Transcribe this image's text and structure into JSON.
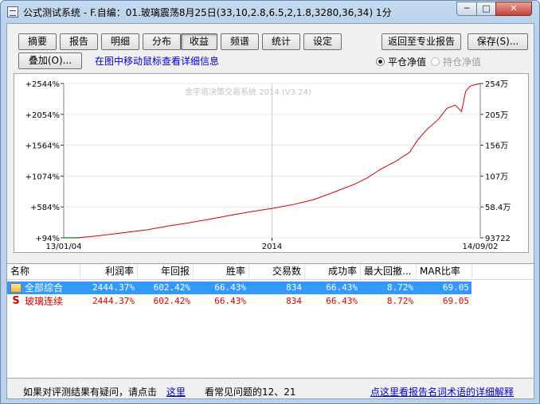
{
  "window": {
    "title": "公式测试系统 - F.自编：01.玻璃震荡8月25日(33,10,2.8,6.5,2,1.8,3280,36,34) 1分",
    "min_glyph": "─",
    "max_glyph": "□",
    "close_glyph": "✕"
  },
  "tabs": [
    {
      "label": "摘要",
      "active": false
    },
    {
      "label": "报告",
      "active": false
    },
    {
      "label": "明细",
      "active": false
    },
    {
      "label": "分布",
      "active": false
    },
    {
      "label": "收益",
      "active": true
    },
    {
      "label": "频谱",
      "active": false
    },
    {
      "label": "统计",
      "active": false
    },
    {
      "label": "设定",
      "active": false
    }
  ],
  "toolbar": {
    "return_label": "返回至专业报告",
    "save_label": "保存(S)...",
    "overlay_label": "叠加(O)...",
    "hint": "在图中移动鼠标查看详细信息"
  },
  "mode": {
    "options": [
      {
        "label": "平仓净值",
        "selected": true
      },
      {
        "label": "持仓净值",
        "selected": false
      }
    ]
  },
  "chart_data": {
    "type": "line",
    "title": "",
    "watermark": "金字塔决策交易系统 2014 (V3.24)",
    "line_color": "#d40000",
    "grid": true,
    "y_left_ticks": [
      "+2544%",
      "+2054%",
      "+1564%",
      "+1074%",
      "+584%",
      "+94%"
    ],
    "y_right_ticks": [
      "254万",
      "205万",
      "156万",
      "107万",
      "58.4万",
      "93722"
    ],
    "x_ticks": [
      "13/01/04",
      "2014",
      "14/09/02"
    ],
    "ylim": [
      94,
      2544
    ],
    "series": [
      {
        "x": [
          0,
          0.03,
          0.06,
          0.1,
          0.15,
          0.2,
          0.25,
          0.3,
          0.35,
          0.4,
          0.45,
          0.5,
          0.55,
          0.6,
          0.65,
          0.7,
          0.73,
          0.76,
          0.8,
          0.83,
          0.85,
          0.87,
          0.9,
          0.92,
          0.94,
          0.955,
          0.965,
          0.975,
          0.985,
          1.0
        ],
        "values": [
          94,
          94,
          110,
          140,
          180,
          220,
          280,
          330,
          390,
          450,
          510,
          560,
          620,
          700,
          820,
          950,
          1050,
          1180,
          1320,
          1450,
          1650,
          1800,
          1980,
          2150,
          2200,
          2100,
          2420,
          2500,
          2520,
          2544
        ]
      }
    ]
  },
  "table": {
    "columns": [
      "名称",
      "利润率",
      "年回报",
      "胜率",
      "交易数",
      "成功率",
      "最大回撤...",
      "MAR比率"
    ],
    "rows": [
      {
        "name": "全部综合",
        "icon": "folder-icon",
        "values": [
          "2444.37%",
          "602.42%",
          "66.43%",
          "834",
          "66.43%",
          "8.72%",
          "69.05"
        ]
      },
      {
        "name": "玻璃连续",
        "icon": "s-icon",
        "icon_text": "S",
        "values": [
          "2444.37%",
          "602.42%",
          "66.43%",
          "834",
          "66.43%",
          "8.72%",
          "69.05"
        ]
      }
    ]
  },
  "footer": {
    "question_text": "如果对评测结果有疑问，请点击",
    "here_link": "这里",
    "faq_text": "看常见问题的12、21",
    "glossary_link": "点这里看报告名词术语的详细解释"
  }
}
